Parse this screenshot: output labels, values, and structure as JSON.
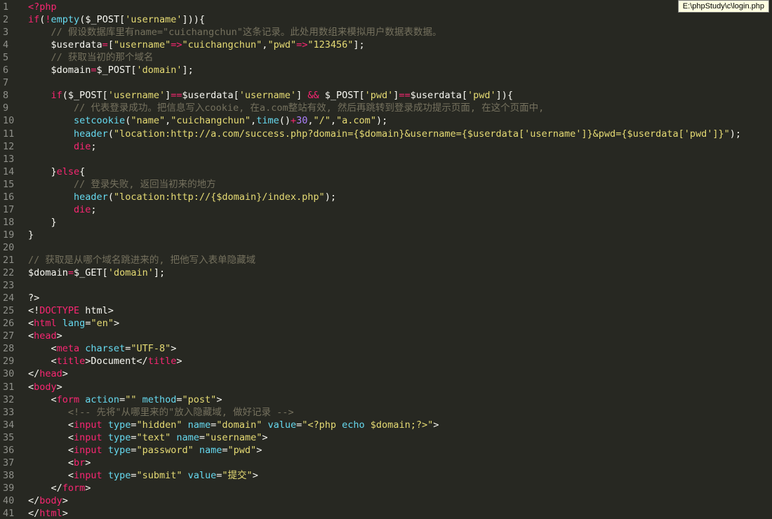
{
  "editor": {
    "tooltip_path": "E:\\phpStudy\\c\\login.php"
  },
  "colors": {
    "background": "#272822",
    "line_number": "#8f908a",
    "plain": "#f8f8f2",
    "keyword": "#f92672",
    "string": "#e6db74",
    "function": "#66d9ef",
    "comment": "#75715e",
    "number": "#ae81ff"
  },
  "lines": [
    {
      "n": "1",
      "tokens": [
        [
          "kw",
          "<?php"
        ]
      ]
    },
    {
      "n": "2",
      "tokens": [
        [
          "kw",
          "if"
        ],
        [
          "p",
          "("
        ],
        [
          "kw",
          "!"
        ],
        [
          "fn",
          "empty"
        ],
        [
          "p",
          "($_POST["
        ],
        [
          "str",
          "'username'"
        ],
        [
          "p",
          "])){"
        ]
      ]
    },
    {
      "n": "3",
      "tokens": [
        [
          "p",
          "    "
        ],
        [
          "cm",
          "// 假设数据库里有name=\"cuichangchun\"这条记录。此处用数组来模拟用户数据表数据。"
        ]
      ]
    },
    {
      "n": "4",
      "tokens": [
        [
          "p",
          "    $userdata"
        ],
        [
          "kw",
          "="
        ],
        [
          "p",
          "["
        ],
        [
          "str",
          "\"username\""
        ],
        [
          "kw",
          "=>"
        ],
        [
          "str",
          "\"cuichangchun\""
        ],
        [
          "p",
          ","
        ],
        [
          "str",
          "\"pwd\""
        ],
        [
          "kw",
          "=>"
        ],
        [
          "str",
          "\"123456\""
        ],
        [
          "p",
          "];"
        ]
      ]
    },
    {
      "n": "5",
      "tokens": [
        [
          "p",
          "    "
        ],
        [
          "cm",
          "// 获取当初的那个域名"
        ]
      ]
    },
    {
      "n": "6",
      "tokens": [
        [
          "p",
          "    $domain"
        ],
        [
          "kw",
          "="
        ],
        [
          "p",
          "$_POST["
        ],
        [
          "str",
          "'domain'"
        ],
        [
          "p",
          "];"
        ]
      ]
    },
    {
      "n": "7",
      "tokens": []
    },
    {
      "n": "8",
      "tokens": [
        [
          "p",
          "    "
        ],
        [
          "kw",
          "if"
        ],
        [
          "p",
          "($_POST["
        ],
        [
          "str",
          "'username'"
        ],
        [
          "p",
          "]"
        ],
        [
          "kw",
          "=="
        ],
        [
          "p",
          "$userdata["
        ],
        [
          "str",
          "'username'"
        ],
        [
          "p",
          "] "
        ],
        [
          "kw",
          "&&"
        ],
        [
          "p",
          " $_POST["
        ],
        [
          "str",
          "'pwd'"
        ],
        [
          "p",
          "]"
        ],
        [
          "kw",
          "=="
        ],
        [
          "p",
          "$userdata["
        ],
        [
          "str",
          "'pwd'"
        ],
        [
          "p",
          "]){"
        ]
      ]
    },
    {
      "n": "9",
      "tokens": [
        [
          "p",
          "        "
        ],
        [
          "cm",
          "// 代表登录成功。把信息写入cookie, 在a.com整站有效, 然后再跳转到登录成功提示页面, 在这个页面中,"
        ]
      ]
    },
    {
      "n": "10",
      "tokens": [
        [
          "p",
          "        "
        ],
        [
          "fn",
          "setcookie"
        ],
        [
          "p",
          "("
        ],
        [
          "str",
          "\"name\""
        ],
        [
          "p",
          ","
        ],
        [
          "str",
          "\"cuichangchun\""
        ],
        [
          "p",
          ","
        ],
        [
          "fn",
          "time"
        ],
        [
          "p",
          "()"
        ],
        [
          "kw",
          "+"
        ],
        [
          "num",
          "30"
        ],
        [
          "p",
          ","
        ],
        [
          "str",
          "\"/\""
        ],
        [
          "p",
          ","
        ],
        [
          "str",
          "\"a.com\""
        ],
        [
          "p",
          ");"
        ]
      ]
    },
    {
      "n": "11",
      "tokens": [
        [
          "p",
          "        "
        ],
        [
          "fn",
          "header"
        ],
        [
          "p",
          "("
        ],
        [
          "str",
          "\"location:http://a.com/success.php?domain={$domain}&username={$userdata['username']}&pwd={$userdata['pwd']}\""
        ],
        [
          "p",
          ");"
        ]
      ]
    },
    {
      "n": "12",
      "tokens": [
        [
          "p",
          "        "
        ],
        [
          "kw",
          "die"
        ],
        [
          "p",
          ";"
        ]
      ]
    },
    {
      "n": "13",
      "tokens": []
    },
    {
      "n": "14",
      "tokens": [
        [
          "p",
          "    }"
        ],
        [
          "kw",
          "else"
        ],
        [
          "p",
          "{"
        ]
      ]
    },
    {
      "n": "15",
      "tokens": [
        [
          "p",
          "        "
        ],
        [
          "cm",
          "// 登录失败, 返回当初来的地方"
        ]
      ]
    },
    {
      "n": "16",
      "tokens": [
        [
          "p",
          "        "
        ],
        [
          "fn",
          "header"
        ],
        [
          "p",
          "("
        ],
        [
          "str",
          "\"location:http://{$domain}/index.php\""
        ],
        [
          "p",
          ");"
        ]
      ]
    },
    {
      "n": "17",
      "tokens": [
        [
          "p",
          "        "
        ],
        [
          "kw",
          "die"
        ],
        [
          "p",
          ";"
        ]
      ]
    },
    {
      "n": "18",
      "tokens": [
        [
          "p",
          "    }"
        ]
      ]
    },
    {
      "n": "19",
      "tokens": [
        [
          "p",
          "}"
        ]
      ]
    },
    {
      "n": "20",
      "tokens": []
    },
    {
      "n": "21",
      "tokens": [
        [
          "cm",
          "// 获取是从哪个域名跳进来的, 把他写入表单隐藏域"
        ]
      ]
    },
    {
      "n": "22",
      "tokens": [
        [
          "p",
          "$domain"
        ],
        [
          "kw",
          "="
        ],
        [
          "p",
          "$_GET["
        ],
        [
          "str",
          "'domain'"
        ],
        [
          "p",
          "];"
        ]
      ]
    },
    {
      "n": "23",
      "tokens": []
    },
    {
      "n": "24",
      "tokens": [
        [
          "p",
          "?>"
        ]
      ]
    },
    {
      "n": "25",
      "tokens": [
        [
          "p",
          "<!"
        ],
        [
          "kw",
          "DOCTYPE"
        ],
        [
          "p",
          " html>"
        ]
      ]
    },
    {
      "n": "26",
      "tokens": [
        [
          "p",
          "<"
        ],
        [
          "kw",
          "html"
        ],
        [
          "p",
          " "
        ],
        [
          "fn",
          "lang"
        ],
        [
          "p",
          "="
        ],
        [
          "str",
          "\"en\""
        ],
        [
          "p",
          ">"
        ]
      ]
    },
    {
      "n": "27",
      "tokens": [
        [
          "p",
          "<"
        ],
        [
          "kw",
          "head"
        ],
        [
          "p",
          ">"
        ]
      ]
    },
    {
      "n": "28",
      "tokens": [
        [
          "p",
          "    <"
        ],
        [
          "kw",
          "meta"
        ],
        [
          "p",
          " "
        ],
        [
          "fn",
          "charset"
        ],
        [
          "p",
          "="
        ],
        [
          "str",
          "\"UTF-8\""
        ],
        [
          "p",
          ">"
        ]
      ]
    },
    {
      "n": "29",
      "tokens": [
        [
          "p",
          "    <"
        ],
        [
          "kw",
          "title"
        ],
        [
          "p",
          ">Document</"
        ],
        [
          "kw",
          "title"
        ],
        [
          "p",
          ">"
        ]
      ]
    },
    {
      "n": "30",
      "tokens": [
        [
          "p",
          "</"
        ],
        [
          "kw",
          "head"
        ],
        [
          "p",
          ">"
        ]
      ]
    },
    {
      "n": "31",
      "tokens": [
        [
          "p",
          "<"
        ],
        [
          "kw",
          "body"
        ],
        [
          "p",
          ">"
        ]
      ]
    },
    {
      "n": "32",
      "tokens": [
        [
          "p",
          "    <"
        ],
        [
          "kw",
          "form"
        ],
        [
          "p",
          " "
        ],
        [
          "fn",
          "action"
        ],
        [
          "p",
          "="
        ],
        [
          "str",
          "\"\""
        ],
        [
          "p",
          " "
        ],
        [
          "fn",
          "method"
        ],
        [
          "p",
          "="
        ],
        [
          "str",
          "\"post\""
        ],
        [
          "p",
          ">"
        ]
      ]
    },
    {
      "n": "33",
      "tokens": [
        [
          "p",
          "       "
        ],
        [
          "cm",
          "<!-- 先将\"从哪里来的\"放入隐藏域, 做好记录 -->"
        ]
      ]
    },
    {
      "n": "34",
      "tokens": [
        [
          "p",
          "       <"
        ],
        [
          "kw",
          "input"
        ],
        [
          "p",
          " "
        ],
        [
          "fn",
          "type"
        ],
        [
          "p",
          "="
        ],
        [
          "str",
          "\"hidden\""
        ],
        [
          "p",
          " "
        ],
        [
          "fn",
          "name"
        ],
        [
          "p",
          "="
        ],
        [
          "str",
          "\"domain\""
        ],
        [
          "p",
          " "
        ],
        [
          "fn",
          "value"
        ],
        [
          "p",
          "="
        ],
        [
          "str",
          "\"<?php "
        ],
        [
          "fn",
          "echo"
        ],
        [
          "str",
          " $domain;?>\""
        ],
        [
          "p",
          ">"
        ]
      ]
    },
    {
      "n": "35",
      "tokens": [
        [
          "p",
          "       <"
        ],
        [
          "kw",
          "input"
        ],
        [
          "p",
          " "
        ],
        [
          "fn",
          "type"
        ],
        [
          "p",
          "="
        ],
        [
          "str",
          "\"text\""
        ],
        [
          "p",
          " "
        ],
        [
          "fn",
          "name"
        ],
        [
          "p",
          "="
        ],
        [
          "str",
          "\"username\""
        ],
        [
          "p",
          ">"
        ]
      ]
    },
    {
      "n": "36",
      "tokens": [
        [
          "p",
          "       <"
        ],
        [
          "kw",
          "input"
        ],
        [
          "p",
          " "
        ],
        [
          "fn",
          "type"
        ],
        [
          "p",
          "="
        ],
        [
          "str",
          "\"password\""
        ],
        [
          "p",
          " "
        ],
        [
          "fn",
          "name"
        ],
        [
          "p",
          "="
        ],
        [
          "str",
          "\"pwd\""
        ],
        [
          "p",
          ">"
        ]
      ]
    },
    {
      "n": "37",
      "tokens": [
        [
          "p",
          "       <"
        ],
        [
          "kw",
          "br"
        ],
        [
          "p",
          ">"
        ]
      ]
    },
    {
      "n": "38",
      "tokens": [
        [
          "p",
          "       <"
        ],
        [
          "kw",
          "input"
        ],
        [
          "p",
          " "
        ],
        [
          "fn",
          "type"
        ],
        [
          "p",
          "="
        ],
        [
          "str",
          "\"submit\""
        ],
        [
          "p",
          " "
        ],
        [
          "fn",
          "value"
        ],
        [
          "p",
          "="
        ],
        [
          "str",
          "\"提交\""
        ],
        [
          "p",
          ">"
        ]
      ]
    },
    {
      "n": "39",
      "tokens": [
        [
          "p",
          "    </"
        ],
        [
          "kw",
          "form"
        ],
        [
          "p",
          ">"
        ]
      ]
    },
    {
      "n": "40",
      "tokens": [
        [
          "p",
          "</"
        ],
        [
          "kw",
          "body"
        ],
        [
          "p",
          ">"
        ]
      ]
    },
    {
      "n": "41",
      "tokens": [
        [
          "p",
          "</"
        ],
        [
          "kw",
          "html"
        ],
        [
          "p",
          ">"
        ]
      ]
    }
  ]
}
